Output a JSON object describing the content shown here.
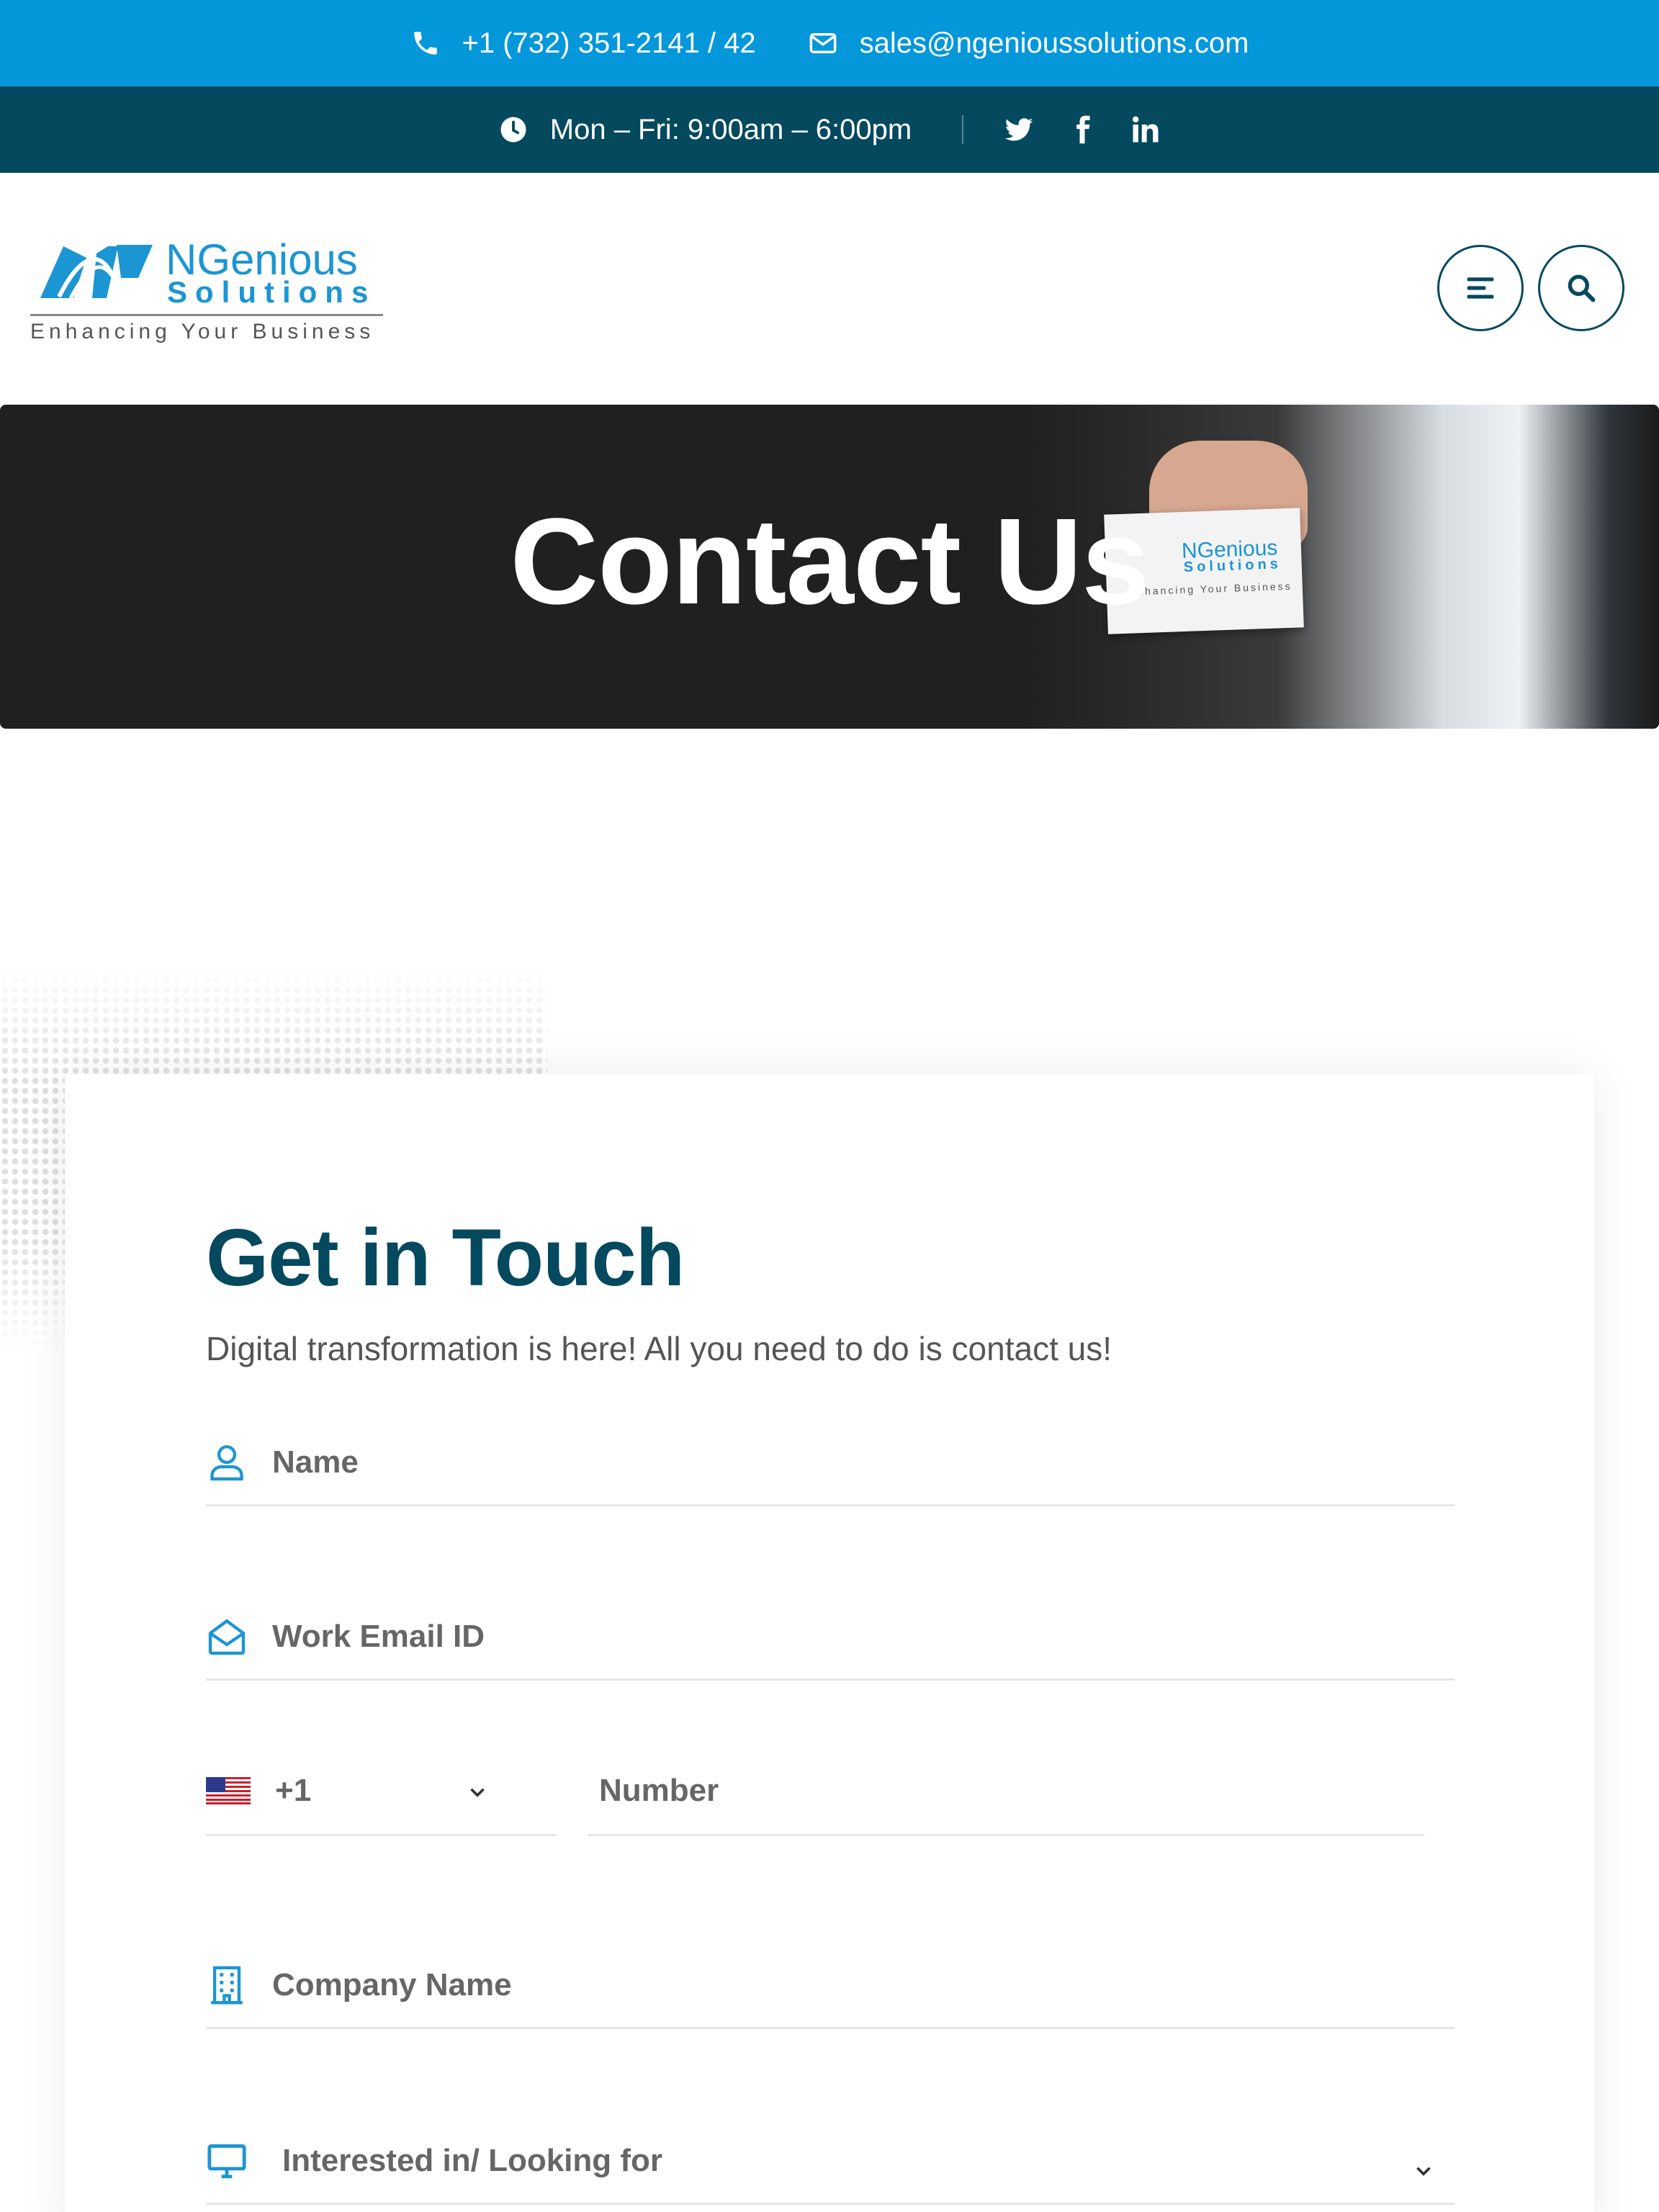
{
  "topbar": {
    "phone": "+1 (732) 351-2141 / 42",
    "email": "sales@ngenioussolutions.com",
    "background": "#0497da"
  },
  "hoursbar": {
    "hours": "Mon – Fri: 9:00am – 6:00pm",
    "background": "#05495f",
    "social": [
      "twitter-icon",
      "facebook-icon",
      "linkedin-icon"
    ]
  },
  "logo": {
    "brand_line1": "NGenious",
    "brand_line2": "Solutions",
    "tagline": "Enhancing Your Business"
  },
  "hero": {
    "title": "Contact Us",
    "card_brand1": "NGenious",
    "card_brand2": "Solutions",
    "card_tagline": "Enhancing Your Business"
  },
  "form": {
    "heading": "Get in Touch",
    "subheading": "Digital transformation is here! All you need to do is contact us!",
    "name_placeholder": "Name",
    "email_placeholder": "Work Email ID",
    "country_code": "+1",
    "number_placeholder": "Number",
    "company_placeholder": "Company Name",
    "interest_placeholder": "Interested in/ Looking for"
  },
  "colors": {
    "accent": "#0497da",
    "dark": "#05495f",
    "icon_blue": "#1c95d3"
  }
}
